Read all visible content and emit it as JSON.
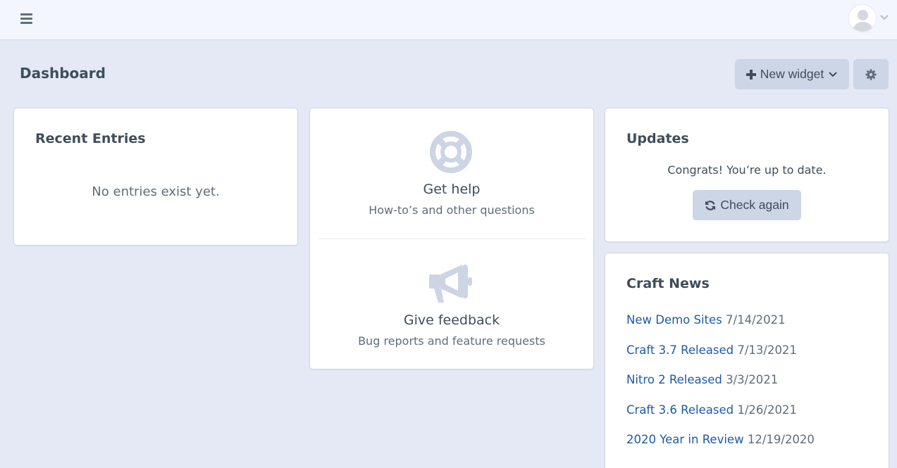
{
  "header": {
    "menu_icon": "hamburger-icon",
    "avatar_icon": "user-avatar-icon"
  },
  "page": {
    "title": "Dashboard",
    "new_widget_label": "New widget",
    "settings_icon": "gear-icon"
  },
  "widgets": {
    "recent_entries": {
      "title": "Recent Entries",
      "empty_text": "No entries exist yet."
    },
    "help": {
      "items": [
        {
          "icon": "lifebuoy-icon",
          "title": "Get help",
          "description": "How-to’s and other questions"
        },
        {
          "icon": "megaphone-icon",
          "title": "Give feedback",
          "description": "Bug reports and feature requests"
        }
      ]
    },
    "updates": {
      "title": "Updates",
      "status": "Congrats! You’re up to date.",
      "check_again_label": "Check again"
    },
    "news": {
      "title": "Craft News",
      "items": [
        {
          "title": "New Demo Sites",
          "date": "7/14/2021"
        },
        {
          "title": "Craft 3.7 Released",
          "date": "7/13/2021"
        },
        {
          "title": "Nitro 2 Released",
          "date": "3/3/2021"
        },
        {
          "title": "Craft 3.6 Released",
          "date": "1/26/2021"
        },
        {
          "title": "2020 Year in Review",
          "date": "12/19/2020"
        }
      ]
    }
  },
  "colors": {
    "background": "#e4e9f5",
    "link": "#1e5aa5",
    "button": "#cdd6e6",
    "icon_muted": "#cdd4e3"
  }
}
